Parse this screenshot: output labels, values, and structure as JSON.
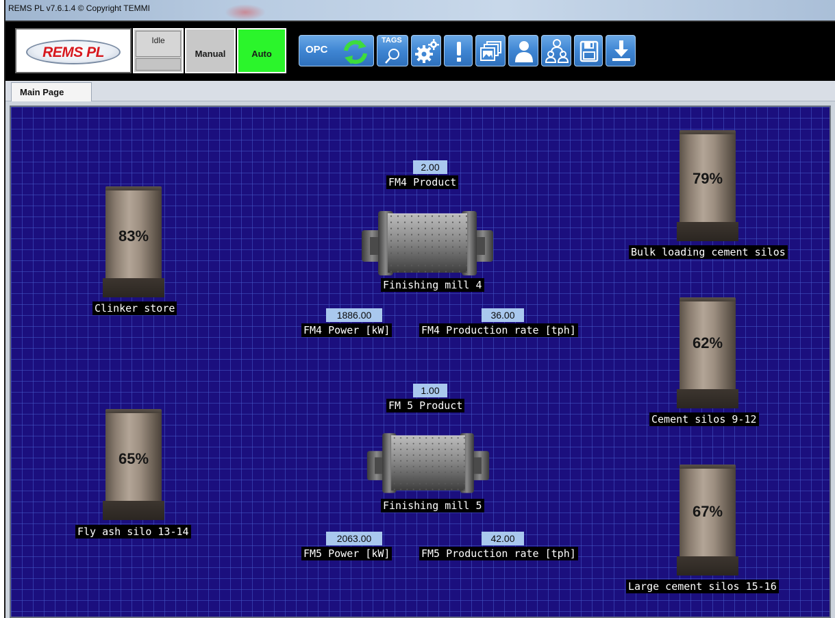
{
  "window": {
    "title": "REMS PL v7.6.1.4 © Copyright TEMMI"
  },
  "toolbar": {
    "logo_text": "REMS PL",
    "mode_idle": "Idle",
    "mode_manual": "Manual",
    "mode_auto": "Auto",
    "opc_label": "OPC",
    "tags_label": "TAGS",
    "auto_color": "#2bf52b"
  },
  "tabs": [
    {
      "label": "Main Page"
    }
  ],
  "plant": {
    "fm4": {
      "product_value": "2.00",
      "product_label": "FM4 Product",
      "mill_label": "Finishing mill 4",
      "power_value": "1886.00",
      "power_label": "FM4 Power [kW]",
      "rate_value": "36.00",
      "rate_label": "FM4 Production rate [tph]"
    },
    "fm5": {
      "product_value": "1.00",
      "product_label": "FM 5 Product",
      "mill_label": "Finishing mill 5",
      "power_value": "2063.00",
      "power_label": "FM5 Power [kW]",
      "rate_value": "42.00",
      "rate_label": "FM5 Production rate [tph]"
    },
    "silos": {
      "clinker": {
        "label": "Clinker store",
        "level": "83%"
      },
      "flyash": {
        "label": "Fly ash silo 13-14",
        "level": "65%"
      },
      "bulk": {
        "label": "Bulk loading cement silos",
        "level": "79%"
      },
      "cement": {
        "label": "Cement silos 9-12",
        "level": "62%"
      },
      "large": {
        "label": "Large cement silos 15-16",
        "level": "67%"
      }
    }
  }
}
